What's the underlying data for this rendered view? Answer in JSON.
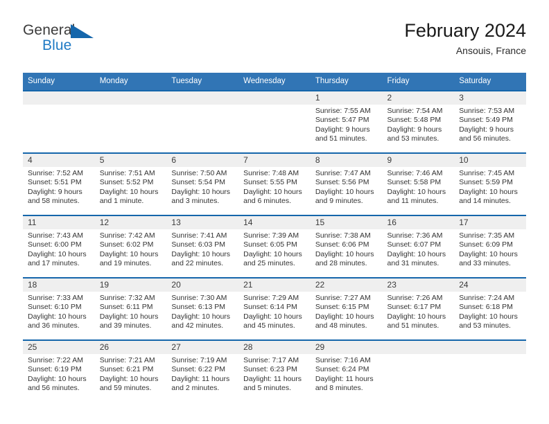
{
  "brand": {
    "line1": "General",
    "line2": "Blue",
    "accent_color": "#1566ab"
  },
  "header": {
    "title": "February 2024",
    "location": "Ansouis, France"
  },
  "calendar": {
    "header_bg": "#3175b5",
    "row_divider_color": "#1566ab",
    "daynum_bg": "#efefef",
    "weekdays": [
      "Sunday",
      "Monday",
      "Tuesday",
      "Wednesday",
      "Thursday",
      "Friday",
      "Saturday"
    ],
    "labels": {
      "sunrise": "Sunrise:",
      "sunset": "Sunset:",
      "daylight": "Daylight:"
    },
    "weeks": [
      [
        {
          "day": "",
          "sunrise": "",
          "sunset": "",
          "daylight": ""
        },
        {
          "day": "",
          "sunrise": "",
          "sunset": "",
          "daylight": ""
        },
        {
          "day": "",
          "sunrise": "",
          "sunset": "",
          "daylight": ""
        },
        {
          "day": "",
          "sunrise": "",
          "sunset": "",
          "daylight": ""
        },
        {
          "day": "1",
          "sunrise": "Sunrise: 7:55 AM",
          "sunset": "Sunset: 5:47 PM",
          "daylight": "Daylight: 9 hours and 51 minutes."
        },
        {
          "day": "2",
          "sunrise": "Sunrise: 7:54 AM",
          "sunset": "Sunset: 5:48 PM",
          "daylight": "Daylight: 9 hours and 53 minutes."
        },
        {
          "day": "3",
          "sunrise": "Sunrise: 7:53 AM",
          "sunset": "Sunset: 5:49 PM",
          "daylight": "Daylight: 9 hours and 56 minutes."
        }
      ],
      [
        {
          "day": "4",
          "sunrise": "Sunrise: 7:52 AM",
          "sunset": "Sunset: 5:51 PM",
          "daylight": "Daylight: 9 hours and 58 minutes."
        },
        {
          "day": "5",
          "sunrise": "Sunrise: 7:51 AM",
          "sunset": "Sunset: 5:52 PM",
          "daylight": "Daylight: 10 hours and 1 minute."
        },
        {
          "day": "6",
          "sunrise": "Sunrise: 7:50 AM",
          "sunset": "Sunset: 5:54 PM",
          "daylight": "Daylight: 10 hours and 3 minutes."
        },
        {
          "day": "7",
          "sunrise": "Sunrise: 7:48 AM",
          "sunset": "Sunset: 5:55 PM",
          "daylight": "Daylight: 10 hours and 6 minutes."
        },
        {
          "day": "8",
          "sunrise": "Sunrise: 7:47 AM",
          "sunset": "Sunset: 5:56 PM",
          "daylight": "Daylight: 10 hours and 9 minutes."
        },
        {
          "day": "9",
          "sunrise": "Sunrise: 7:46 AM",
          "sunset": "Sunset: 5:58 PM",
          "daylight": "Daylight: 10 hours and 11 minutes."
        },
        {
          "day": "10",
          "sunrise": "Sunrise: 7:45 AM",
          "sunset": "Sunset: 5:59 PM",
          "daylight": "Daylight: 10 hours and 14 minutes."
        }
      ],
      [
        {
          "day": "11",
          "sunrise": "Sunrise: 7:43 AM",
          "sunset": "Sunset: 6:00 PM",
          "daylight": "Daylight: 10 hours and 17 minutes."
        },
        {
          "day": "12",
          "sunrise": "Sunrise: 7:42 AM",
          "sunset": "Sunset: 6:02 PM",
          "daylight": "Daylight: 10 hours and 19 minutes."
        },
        {
          "day": "13",
          "sunrise": "Sunrise: 7:41 AM",
          "sunset": "Sunset: 6:03 PM",
          "daylight": "Daylight: 10 hours and 22 minutes."
        },
        {
          "day": "14",
          "sunrise": "Sunrise: 7:39 AM",
          "sunset": "Sunset: 6:05 PM",
          "daylight": "Daylight: 10 hours and 25 minutes."
        },
        {
          "day": "15",
          "sunrise": "Sunrise: 7:38 AM",
          "sunset": "Sunset: 6:06 PM",
          "daylight": "Daylight: 10 hours and 28 minutes."
        },
        {
          "day": "16",
          "sunrise": "Sunrise: 7:36 AM",
          "sunset": "Sunset: 6:07 PM",
          "daylight": "Daylight: 10 hours and 31 minutes."
        },
        {
          "day": "17",
          "sunrise": "Sunrise: 7:35 AM",
          "sunset": "Sunset: 6:09 PM",
          "daylight": "Daylight: 10 hours and 33 minutes."
        }
      ],
      [
        {
          "day": "18",
          "sunrise": "Sunrise: 7:33 AM",
          "sunset": "Sunset: 6:10 PM",
          "daylight": "Daylight: 10 hours and 36 minutes."
        },
        {
          "day": "19",
          "sunrise": "Sunrise: 7:32 AM",
          "sunset": "Sunset: 6:11 PM",
          "daylight": "Daylight: 10 hours and 39 minutes."
        },
        {
          "day": "20",
          "sunrise": "Sunrise: 7:30 AM",
          "sunset": "Sunset: 6:13 PM",
          "daylight": "Daylight: 10 hours and 42 minutes."
        },
        {
          "day": "21",
          "sunrise": "Sunrise: 7:29 AM",
          "sunset": "Sunset: 6:14 PM",
          "daylight": "Daylight: 10 hours and 45 minutes."
        },
        {
          "day": "22",
          "sunrise": "Sunrise: 7:27 AM",
          "sunset": "Sunset: 6:15 PM",
          "daylight": "Daylight: 10 hours and 48 minutes."
        },
        {
          "day": "23",
          "sunrise": "Sunrise: 7:26 AM",
          "sunset": "Sunset: 6:17 PM",
          "daylight": "Daylight: 10 hours and 51 minutes."
        },
        {
          "day": "24",
          "sunrise": "Sunrise: 7:24 AM",
          "sunset": "Sunset: 6:18 PM",
          "daylight": "Daylight: 10 hours and 53 minutes."
        }
      ],
      [
        {
          "day": "25",
          "sunrise": "Sunrise: 7:22 AM",
          "sunset": "Sunset: 6:19 PM",
          "daylight": "Daylight: 10 hours and 56 minutes."
        },
        {
          "day": "26",
          "sunrise": "Sunrise: 7:21 AM",
          "sunset": "Sunset: 6:21 PM",
          "daylight": "Daylight: 10 hours and 59 minutes."
        },
        {
          "day": "27",
          "sunrise": "Sunrise: 7:19 AM",
          "sunset": "Sunset: 6:22 PM",
          "daylight": "Daylight: 11 hours and 2 minutes."
        },
        {
          "day": "28",
          "sunrise": "Sunrise: 7:17 AM",
          "sunset": "Sunset: 6:23 PM",
          "daylight": "Daylight: 11 hours and 5 minutes."
        },
        {
          "day": "29",
          "sunrise": "Sunrise: 7:16 AM",
          "sunset": "Sunset: 6:24 PM",
          "daylight": "Daylight: 11 hours and 8 minutes."
        },
        {
          "day": "",
          "sunrise": "",
          "sunset": "",
          "daylight": ""
        },
        {
          "day": "",
          "sunrise": "",
          "sunset": "",
          "daylight": ""
        }
      ]
    ]
  }
}
